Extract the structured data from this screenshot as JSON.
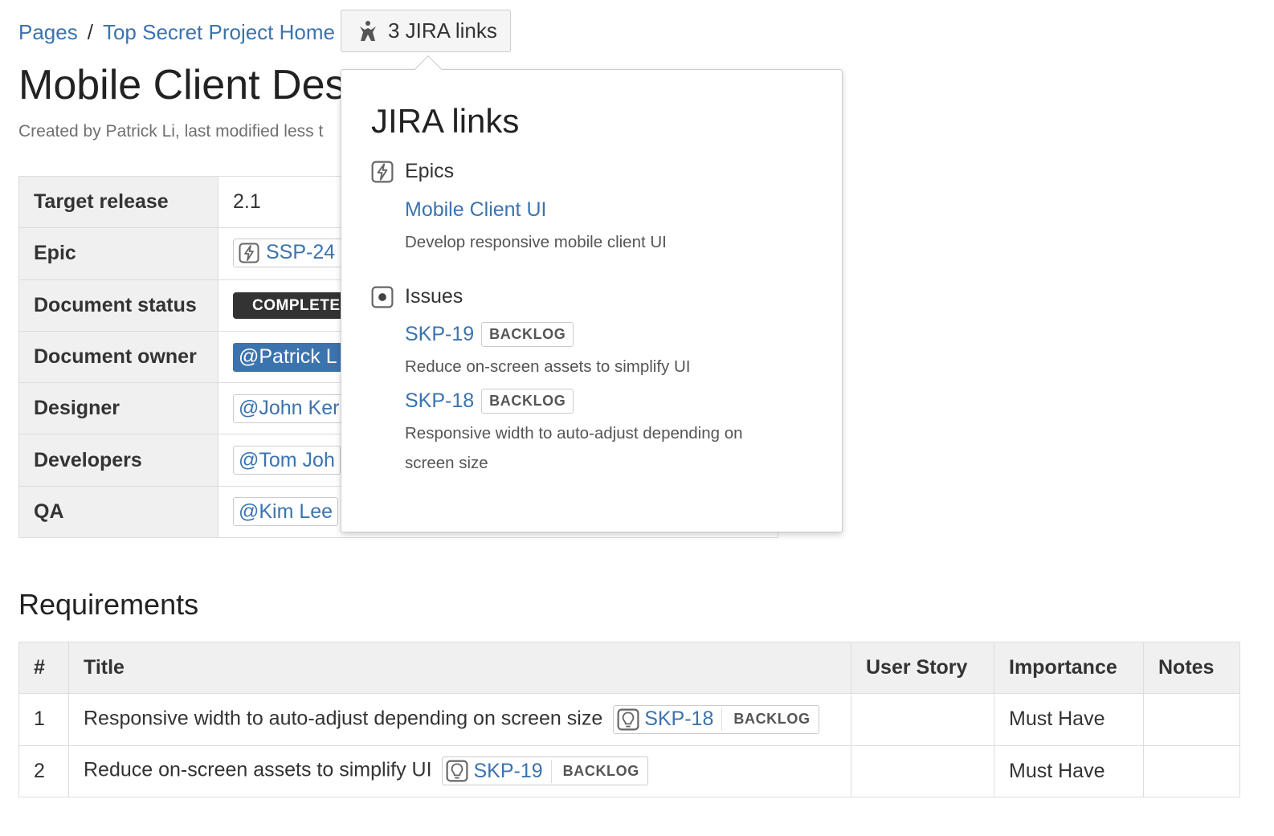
{
  "breadcrumb": {
    "pages": "Pages",
    "separator": "/",
    "parent": "Top Secret Project Home"
  },
  "jira_button": {
    "label": "3 JIRA links"
  },
  "page": {
    "title": "Mobile Client Des",
    "meta": "Created by Patrick Li, last modified less t"
  },
  "properties": {
    "rows": [
      {
        "key": "Target release",
        "value": "2.1"
      },
      {
        "key": "Epic",
        "value": "SSP-24"
      },
      {
        "key": "Document status",
        "value": "COMPLETE"
      },
      {
        "key": "Document owner",
        "value": "@Patrick L"
      },
      {
        "key": "Designer",
        "value": "@John Ker"
      },
      {
        "key": "Developers",
        "value": "@Tom Joh"
      },
      {
        "key": "QA",
        "value": "@Kim Lee"
      }
    ]
  },
  "popup": {
    "title": "JIRA links",
    "epics_label": "Epics",
    "epic": {
      "name": "Mobile Client UI",
      "description": "Develop responsive mobile client UI"
    },
    "issues_label": "Issues",
    "issues": [
      {
        "key": "SKP-19",
        "status": "BACKLOG",
        "description": "Reduce on-screen assets to simplify UI"
      },
      {
        "key": "SKP-18",
        "status": "BACKLOG",
        "description": "Responsive width to auto-adjust depending on screen size"
      }
    ]
  },
  "requirements": {
    "heading": "Requirements",
    "columns": [
      "#",
      "Title",
      "User Story",
      "Importance",
      "Notes"
    ],
    "rows": [
      {
        "num": "1",
        "title": "Responsive width to auto-adjust depending on screen size",
        "issue_key": "SKP-18",
        "issue_status": "BACKLOG",
        "user_story": "",
        "importance": "Must Have",
        "notes": ""
      },
      {
        "num": "2",
        "title": "Reduce on-screen assets to simplify UI",
        "issue_key": "SKP-19",
        "issue_status": "BACKLOG",
        "user_story": "",
        "importance": "Must Have",
        "notes": ""
      }
    ]
  },
  "colors": {
    "link": "#3b73af",
    "header_bg": "#f0f0f0",
    "status_complete_bg": "#333333"
  }
}
